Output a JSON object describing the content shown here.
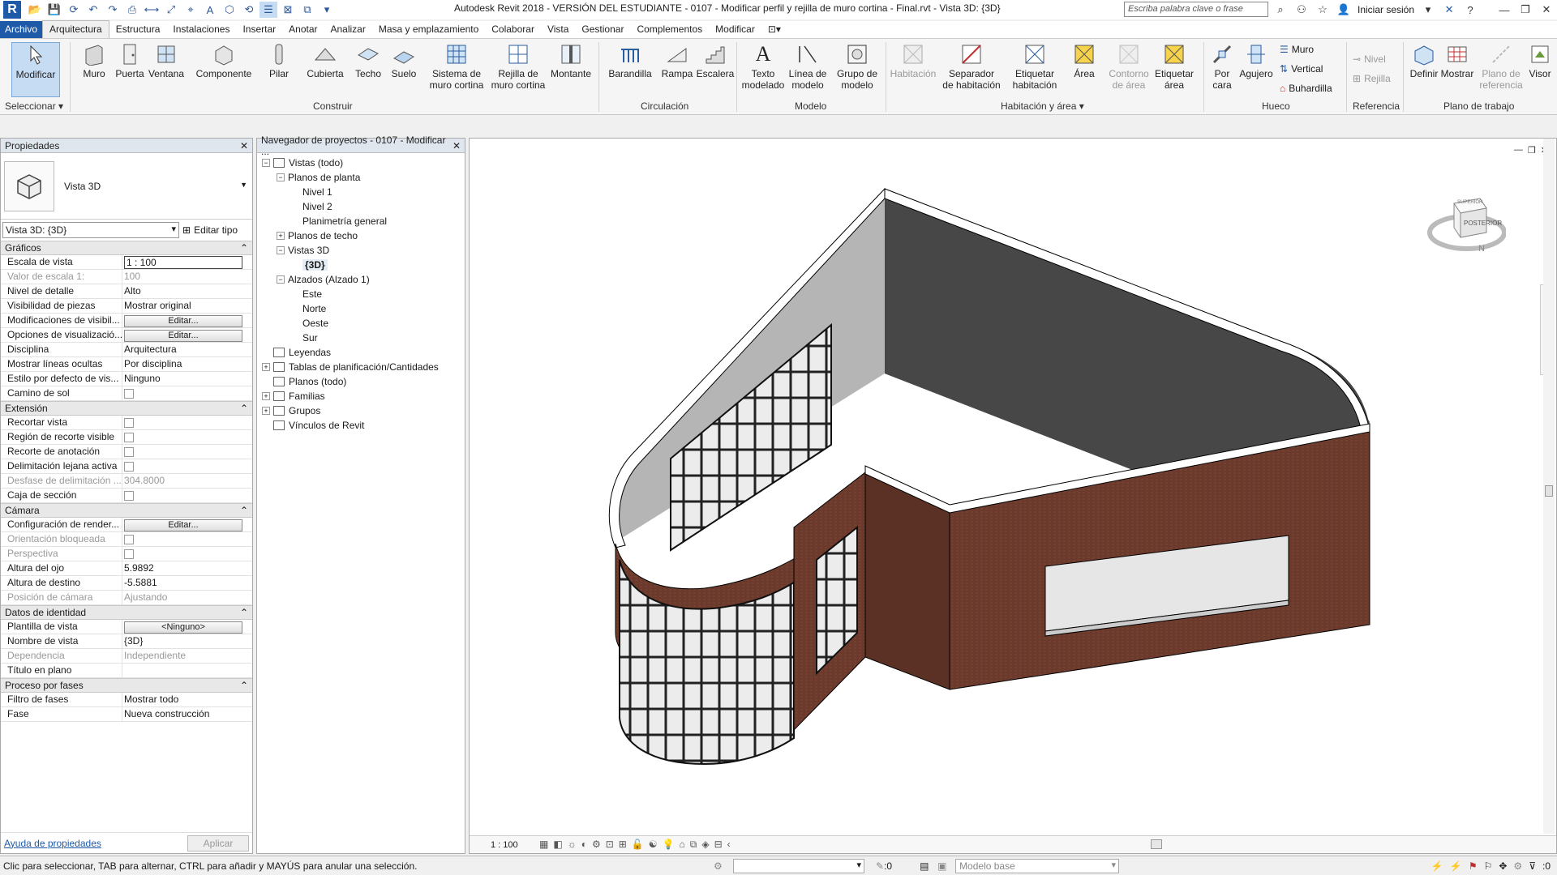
{
  "titlebar": {
    "title": "Autodesk Revit 2018 - VERSIÓN DEL ESTUDIANTE -     0107 - Modificar perfil y rejilla de muro cortina - Final.rvt - Vista 3D: {3D}",
    "search_placeholder": "Escriba palabra clave o frase",
    "signin": "Iniciar sesión",
    "logo": "R"
  },
  "tabs": [
    "Archivo",
    "Arquitectura",
    "Estructura",
    "Instalaciones",
    "Insertar",
    "Anotar",
    "Analizar",
    "Masa y emplazamiento",
    "Colaborar",
    "Vista",
    "Gestionar",
    "Complementos",
    "Modificar"
  ],
  "ribbon": {
    "select": {
      "modify": "Modificar",
      "select_label": "Seleccionar"
    },
    "build": {
      "label": "Construir",
      "items": [
        "Muro",
        "Puerta",
        "Ventana",
        "Componente",
        "Pilar",
        "Cubierta",
        "Techo",
        "Suelo",
        "Sistema de\nmuro cortina",
        "Rejilla de\nmuro cortina",
        "Montante"
      ]
    },
    "circulation": {
      "label": "Circulación",
      "items": [
        "Barandilla",
        "Rampa",
        "Escalera"
      ]
    },
    "model": {
      "label": "Modelo",
      "items": [
        "Texto\nmodelado",
        "Línea de\nmodelo",
        "Grupo de\nmodelo"
      ]
    },
    "room": {
      "label": "Habitación y área",
      "items": [
        "Habitación",
        "Separador\nde habitación",
        "Etiquetar\nhabitación",
        "Área",
        "Contorno\nde área",
        "Etiquetar\nárea"
      ]
    },
    "opening": {
      "label": "Hueco",
      "items": [
        "Por\ncara",
        "Agujero"
      ],
      "small": [
        "Muro",
        "Vertical",
        "Buhardilla"
      ]
    },
    "datum": {
      "label": "Referencia",
      "small": [
        "Nivel",
        "Rejilla"
      ]
    },
    "workplane": {
      "label": "Plano de trabajo",
      "items": [
        "Definir",
        "Mostrar",
        "Plano de\nreferencia",
        "Visor"
      ]
    }
  },
  "properties": {
    "title": "Propiedades",
    "type_name": "Vista 3D",
    "instance": "Vista 3D: {3D}",
    "edit_type": "Editar tipo",
    "groups": [
      {
        "name": "Gráficos",
        "rows": [
          [
            "Escala de vista",
            "1 : 100",
            "input"
          ],
          [
            "Valor de escala    1:",
            "100",
            "dis"
          ],
          [
            "Nivel de detalle",
            "Alto",
            ""
          ],
          [
            "Visibilidad de piezas",
            "Mostrar original",
            ""
          ],
          [
            "Modificaciones de visibil...",
            "Editar...",
            "btn"
          ],
          [
            "Opciones de visualizació...",
            "Editar...",
            "btn"
          ],
          [
            "Disciplina",
            "Arquitectura",
            ""
          ],
          [
            "Mostrar líneas ocultas",
            "Por disciplina",
            ""
          ],
          [
            "Estilo por defecto de vis...",
            "Ninguno",
            ""
          ],
          [
            "Camino de sol",
            "",
            "chk"
          ]
        ]
      },
      {
        "name": "Extensión",
        "rows": [
          [
            "Recortar vista",
            "",
            "chk"
          ],
          [
            "Región de recorte visible",
            "",
            "chk"
          ],
          [
            "Recorte de anotación",
            "",
            "chk"
          ],
          [
            "Delimitación lejana activa",
            "",
            "chk"
          ],
          [
            "Desfase de delimitación ...",
            "304.8000",
            "dis"
          ],
          [
            "Caja de sección",
            "",
            "chk"
          ]
        ]
      },
      {
        "name": "Cámara",
        "rows": [
          [
            "Configuración de render...",
            "Editar...",
            "btn"
          ],
          [
            "Orientación bloqueada",
            "",
            "chkdis"
          ],
          [
            "Perspectiva",
            "",
            "chkdis"
          ],
          [
            "Altura del ojo",
            "5.9892",
            ""
          ],
          [
            "Altura de destino",
            "-5.5881",
            ""
          ],
          [
            "Posición de cámara",
            "Ajustando",
            "dis"
          ]
        ]
      },
      {
        "name": "Datos de identidad",
        "rows": [
          [
            "Plantilla de vista",
            "<Ninguno>",
            "btn"
          ],
          [
            "Nombre de vista",
            "{3D}",
            ""
          ],
          [
            "Dependencia",
            "Independiente",
            "dis"
          ],
          [
            "Título en plano",
            "",
            ""
          ]
        ]
      },
      {
        "name": "Proceso por fases",
        "rows": [
          [
            "Filtro de fases",
            "Mostrar todo",
            ""
          ],
          [
            "Fase",
            "Nueva construcción",
            ""
          ]
        ]
      }
    ],
    "help": "Ayuda de propiedades",
    "apply": "Aplicar"
  },
  "browser": {
    "title": "Navegador de proyectos - 0107 - Modificar ...",
    "tree": [
      {
        "label": "Vistas (todo)",
        "depth": 0,
        "exp": "−",
        "icon": true
      },
      {
        "label": "Planos de planta",
        "depth": 1,
        "exp": "−"
      },
      {
        "label": "Nivel 1",
        "depth": 2
      },
      {
        "label": "Nivel 2",
        "depth": 2
      },
      {
        "label": "Planimetría general",
        "depth": 2
      },
      {
        "label": "Planos de techo",
        "depth": 1,
        "exp": "+"
      },
      {
        "label": "Vistas 3D",
        "depth": 1,
        "exp": "−"
      },
      {
        "label": "{3D}",
        "depth": 2,
        "bold": true
      },
      {
        "label": "Alzados (Alzado 1)",
        "depth": 1,
        "exp": "−"
      },
      {
        "label": "Este",
        "depth": 2
      },
      {
        "label": "Norte",
        "depth": 2
      },
      {
        "label": "Oeste",
        "depth": 2
      },
      {
        "label": "Sur",
        "depth": 2
      },
      {
        "label": "Leyendas",
        "depth": 0,
        "icon": true
      },
      {
        "label": "Tablas de planificación/Cantidades",
        "depth": 0,
        "exp": "+",
        "icon": true
      },
      {
        "label": "Planos (todo)",
        "depth": 0,
        "icon": true
      },
      {
        "label": "Familias",
        "depth": 0,
        "exp": "+",
        "icon": true
      },
      {
        "label": "Grupos",
        "depth": 0,
        "exp": "+",
        "icon": true
      },
      {
        "label": "Vínculos de Revit",
        "depth": 0,
        "icon": true
      }
    ]
  },
  "viewport": {
    "scale": "1 : 100",
    "viewcube_face": "POSTERIOR",
    "viewcube_top": "SUPERIOR",
    "compass_n": "N"
  },
  "status": {
    "message": "Clic para seleccionar, TAB para alternar, CTRL para añadir y MAYÚS para anular una selección.",
    "workset_count": ":0",
    "model": "Modelo base",
    "filter_count": ":0"
  },
  "colors": {
    "accent": "#1e5aa8",
    "brick": "#6b3a2c",
    "selected": "#c5dcf3"
  }
}
